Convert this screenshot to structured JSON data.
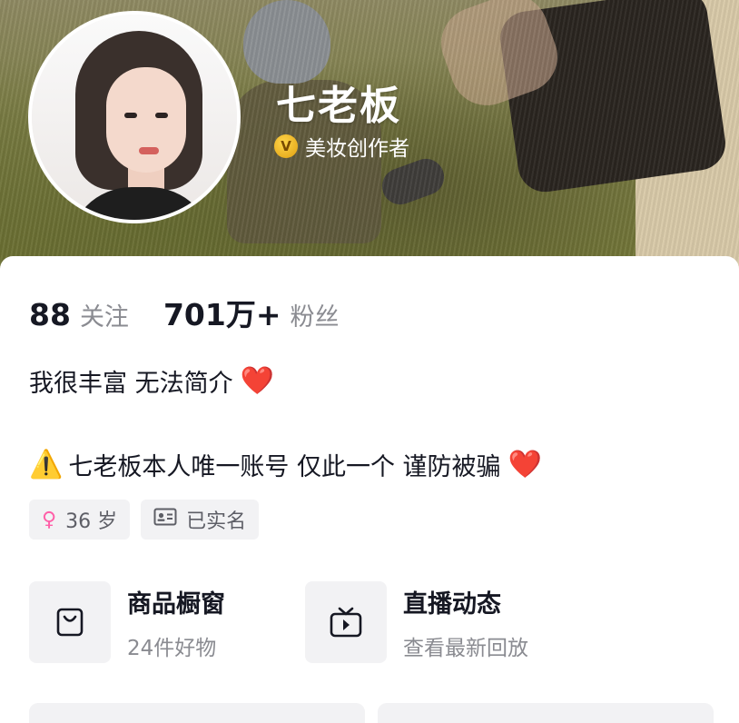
{
  "profile": {
    "nickname": "七老板",
    "verify_badge": "V",
    "verify_text": "美妆创作者"
  },
  "stats": {
    "following_count": "88",
    "following_label": "关注",
    "followers_count": "701万+",
    "followers_label": "粉丝"
  },
  "bio": {
    "line1": "我很丰富 无法简介",
    "line2": "七老板本人唯一账号  仅此一个 谨防被骗",
    "heart_emoji": "❤️",
    "warning_emoji": "⚠️"
  },
  "tags": [
    {
      "icon": "female-icon",
      "glyph": "♀",
      "label": "36 岁"
    },
    {
      "icon": "id-card-icon",
      "label": "已实名"
    }
  ],
  "entries": [
    {
      "icon": "shopping-bag-icon",
      "title": "商品橱窗",
      "subtitle": "24件好物"
    },
    {
      "icon": "tv-icon",
      "title": "直播动态",
      "subtitle": "查看最新回放"
    }
  ],
  "colors": {
    "accent_red": "#ee1d36",
    "verify_gold": "#f0b41e",
    "muted_text": "#8a8b91",
    "tile_bg": "#f2f2f4"
  }
}
